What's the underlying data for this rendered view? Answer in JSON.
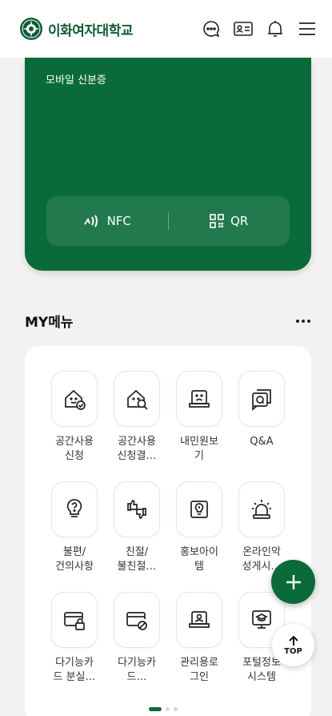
{
  "header": {
    "logo_text": "이화여자대학교",
    "icons": [
      "chat-icon",
      "id-card-icon",
      "bell-icon",
      "menu-icon"
    ]
  },
  "card": {
    "title": "모바일 신분증",
    "nfc_label": "NFC",
    "qr_label": "QR",
    "color": "#0b6a3a"
  },
  "section": {
    "title": "MY메뉴",
    "more_label": "···"
  },
  "menu_items": [
    {
      "label": "공간사용\n신청",
      "icon": "space-request-icon"
    },
    {
      "label": "공간사용\n신청결…",
      "icon": "space-search-icon"
    },
    {
      "label": "내민원보\n기",
      "icon": "complaint-icon"
    },
    {
      "label": "Q&A",
      "icon": "qa-icon"
    },
    {
      "label": "불편/\n건의사항",
      "icon": "lightbulb-question-icon"
    },
    {
      "label": "친절/\n불친절…",
      "icon": "thumbs-icon"
    },
    {
      "label": "홍보아이\n템",
      "icon": "promo-item-icon"
    },
    {
      "label": "온라인악\n성게시…",
      "icon": "alert-siren-icon"
    },
    {
      "label": "다기능카\n드 분실…",
      "icon": "card-lock-icon"
    },
    {
      "label": "다기능카\n드…",
      "icon": "card-block-icon"
    },
    {
      "label": "관리용로\n그인",
      "icon": "admin-login-icon"
    },
    {
      "label": "포털정보\n시스템",
      "icon": "portal-system-icon"
    }
  ],
  "pagination": {
    "current": 1,
    "total": 3
  },
  "fab_label": "+",
  "top_label": "TOP",
  "colors": {
    "accent": "#0b6a3a",
    "background": "#f2f2f2"
  }
}
